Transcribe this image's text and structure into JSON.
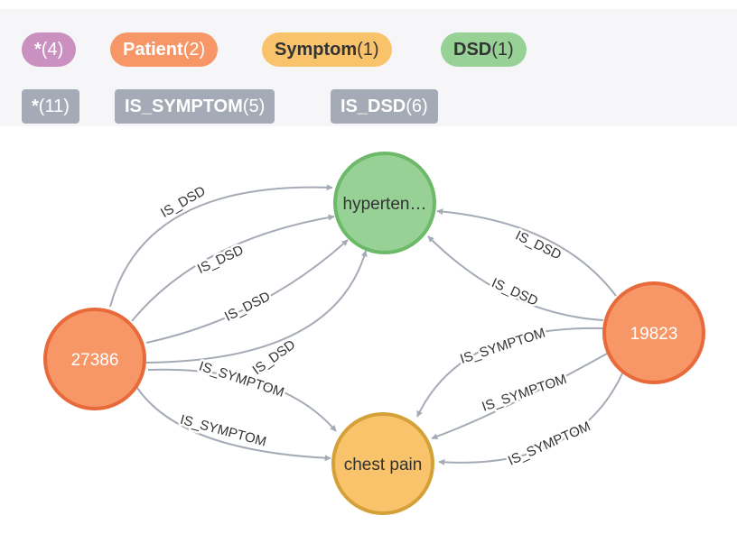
{
  "legend": {
    "node_labels": [
      {
        "name": "*",
        "count": "(4)",
        "color": "#c990c0"
      },
      {
        "name": "Patient",
        "count": "(2)",
        "color": "#f79767"
      },
      {
        "name": "Symptom",
        "count": "(1)",
        "color": "#f8c36a"
      },
      {
        "name": "DSD",
        "count": "(1)",
        "color": "#97d196"
      }
    ],
    "relationship_types": [
      {
        "name": "*",
        "count": "(11)"
      },
      {
        "name": "IS_SYMPTOM",
        "count": "(5)"
      },
      {
        "name": "IS_DSD",
        "count": "(6)"
      }
    ]
  },
  "graph": {
    "nodes": {
      "patient_a": {
        "caption": "27386",
        "label": "Patient",
        "fill": "#f79767",
        "stroke": "#e8693a",
        "text_color": "#ffffff"
      },
      "patient_b": {
        "caption": "19823",
        "label": "Patient",
        "fill": "#f79767",
        "stroke": "#e8693a",
        "text_color": "#ffffff"
      },
      "hypertension": {
        "caption": "hyperten…",
        "label": "DSD",
        "fill": "#97d196",
        "stroke": "#6cba69",
        "text_color": "#333333"
      },
      "chest_pain": {
        "caption": "chest pain",
        "label": "Symptom",
        "fill": "#f8c36a",
        "stroke": "#d4a038",
        "text_color": "#333333"
      }
    },
    "relationships": [
      {
        "id": "a_dsd_1",
        "type": "IS_DSD"
      },
      {
        "id": "a_dsd_2",
        "type": "IS_DSD"
      },
      {
        "id": "a_dsd_3",
        "type": "IS_DSD"
      },
      {
        "id": "a_dsd_4",
        "type": "IS_DSD"
      },
      {
        "id": "a_sym_1",
        "type": "IS_SYMPTOM"
      },
      {
        "id": "a_sym_2",
        "type": "IS_SYMPTOM"
      },
      {
        "id": "b_dsd_1",
        "type": "IS_DSD"
      },
      {
        "id": "b_dsd_2",
        "type": "IS_DSD"
      },
      {
        "id": "b_sym_1",
        "type": "IS_SYMPTOM"
      },
      {
        "id": "b_sym_2",
        "type": "IS_SYMPTOM"
      },
      {
        "id": "b_sym_3",
        "type": "IS_SYMPTOM"
      }
    ]
  }
}
